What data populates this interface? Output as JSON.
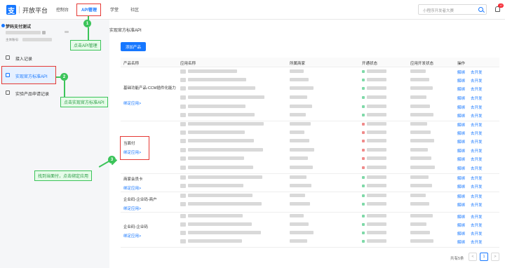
{
  "header": {
    "logo_glyph": "支",
    "logo_text": "开放平台",
    "nav": [
      "控制台",
      "API管理",
      "学堂",
      "社区"
    ],
    "search_placeholder": "小程序开发者大赛",
    "notification_count": "12"
  },
  "account": {
    "name": "梦码支付测试",
    "id_label": "主体账号:"
  },
  "sidebar": {
    "items": [
      {
        "label": "接入记录"
      },
      {
        "label": "实现官方标准API"
      },
      {
        "label": "实验产品申请记录"
      }
    ]
  },
  "main": {
    "page_title": "实现官方标准API",
    "add_button": "添加产品",
    "columns": [
      "产品名称",
      "应用名称",
      "所属商家",
      "开通状态",
      "应用开发状态",
      "操作"
    ],
    "products": [
      {
        "name": "基础功能产品-CCM插件化能力",
        "bind": "绑定应用>"
      },
      {
        "name": "当面付",
        "bind": "绑定应用>"
      },
      {
        "name": "商家会员卡",
        "bind": "绑定应用>"
      },
      {
        "name": "企业码-企业码-商户",
        "bind": "绑定应用>"
      },
      {
        "name": "企业码-企业码",
        "bind": "绑定应用>"
      }
    ],
    "op_unbind": "解绑",
    "op_develop": "去开发",
    "pager_total": "共有5条",
    "pager_current": "1",
    "pager_prev": "<",
    "pager_next": ">"
  },
  "annotations": {
    "step1": "点击API管理",
    "step2": "点击实现官方标准API",
    "step3": "找到当面付，点击绑定应用",
    "n1": "1",
    "n2": "2",
    "n3": "3"
  },
  "colors": {
    "accent": "#1677ff",
    "highlight": "#e53935",
    "callout": "#3cc45a"
  }
}
